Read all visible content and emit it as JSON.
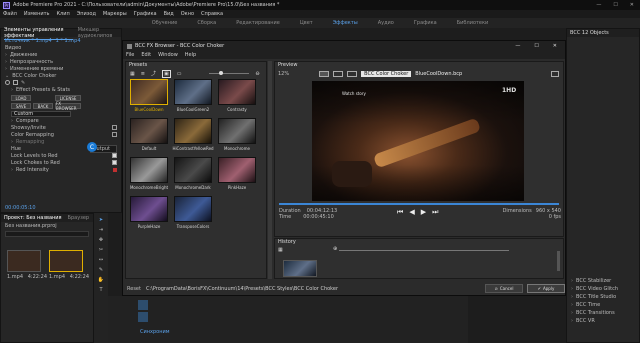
{
  "app": {
    "title": "Adobe Premiere Pro 2021 - C:\\Пользователи\\admin\\Документы\\Adobe\\Premiere Pro\\15.0\\Без названия *"
  },
  "menu": [
    "Файл",
    "Изменить",
    "Клип",
    "Эпизод",
    "Маркеры",
    "Графика",
    "Вид",
    "Окно",
    "Справка"
  ],
  "workspaces": [
    "Обучение",
    "Сборка",
    "Редактирование",
    "Цвет",
    "Эффекты",
    "Аудио",
    "Графика",
    "Библиотеки"
  ],
  "active_workspace": "Эффекты",
  "effect_controls": {
    "tabs": [
      "Элементы управления эффектами",
      "Микшер аудиоклипов"
    ],
    "source": "Источник * 1.mp4",
    "clip": "1 * 1.mp4",
    "sections": [
      "Видео",
      "Движение",
      "Непрозрачность",
      "Изменение времени",
      "BCC Color Choker"
    ],
    "effect_presets": "Effect Presets & Stats",
    "buttons": [
      "LOAD",
      "SAVE",
      "LICENSE",
      "BACK",
      "FX BROWSER"
    ],
    "preset_value": "Custom",
    "params": [
      "Compare",
      "Showsy/Invite",
      "Color Remapping",
      "Remapping",
      "Hue",
      "Lock Levels to Red",
      "Lock Chokes to Red",
      "Red Intensity"
    ],
    "output": "Output",
    "timecode": "00:00:05:10"
  },
  "project": {
    "tabs": [
      "Проект: Без названия",
      "Браузер"
    ],
    "file": "Без названия.prproj",
    "items": [
      {
        "name": "1.mp4",
        "duration": "4:22:24"
      },
      {
        "name": "1.mp4",
        "duration": "4:22:24"
      }
    ]
  },
  "timeline_hint": "Синхроним",
  "dialog": {
    "title": "BCC FX Browser - BCC Color Choker",
    "menu": [
      "File",
      "Edit",
      "Window",
      "Help"
    ],
    "presets_label": "Presets",
    "preview_label": "Preview",
    "pct": "12%",
    "effect_name": "BCC Color Choker",
    "preset_name": "BlueCoolDown.bcp",
    "presets": [
      "BlueCoolDown",
      "BlueCoolGreen2",
      "Contrasty",
      "Default",
      "HiContrastYellowRed",
      "Monochrome",
      "MonochromeBright",
      "MonochromeDark",
      "PinkHaze",
      "PurpleHaze",
      "TransposeColors"
    ],
    "overlay_text": "Watch story",
    "duration_label": "Duration",
    "duration": "00:04:12:13",
    "time_label": "Time",
    "time": "00:00:45:10",
    "dims_label": "Dimensions",
    "dims": "960 x 540",
    "fps": "0 fps",
    "history_label": "History",
    "reset_label": "Reset",
    "path": "C:\\ProgramData\\BorisFX\\Continuum\\14\\Presets\\BCC Styles\\BCC Color Choker",
    "cancel": "Cancel",
    "apply": "Apply"
  },
  "right_panel": {
    "title": "BCC 12 Objects",
    "items": [
      "BCC Stabilizer",
      "BCC Video Glitch",
      "BCC Title Studio",
      "BCC Time",
      "BCC Transitions",
      "BCC VR"
    ]
  },
  "colors": {
    "accent": "#5aa0e8",
    "dialog_bg": "#2b2b2b",
    "selection": "#e0b000",
    "apply_bg": "#3c3c3c"
  }
}
